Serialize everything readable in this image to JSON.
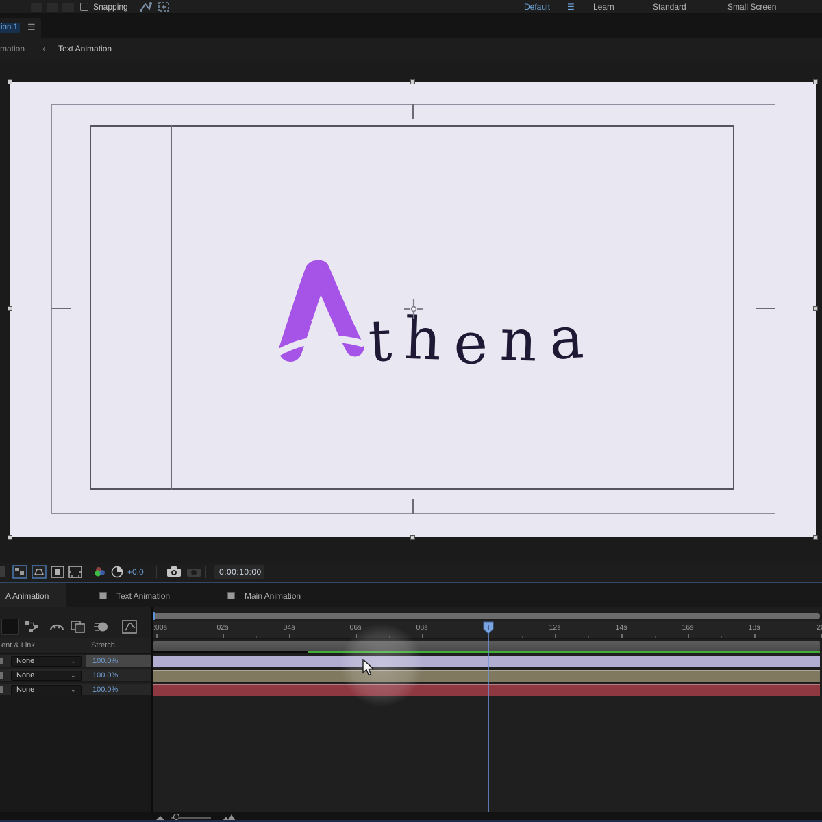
{
  "top_toolbar": {
    "snapping_label": "Snapping",
    "workspaces": [
      {
        "label": "Default",
        "active": true
      },
      {
        "label": "Learn",
        "active": false
      },
      {
        "label": "Standard",
        "active": false
      },
      {
        "label": "Small Screen",
        "active": false
      }
    ]
  },
  "comp_panel": {
    "tab_label": "ion 1",
    "breadcrumb": {
      "parent": "mation",
      "separator": "‹",
      "current": "Text Animation"
    },
    "logo": {
      "initial": "A",
      "rest": "thena",
      "purple": "#a653e8",
      "text_color": "#201936"
    },
    "exposure_value": "+0.0",
    "timecode": "0:00:10:00"
  },
  "timeline": {
    "tabs": [
      {
        "label": "A Animation",
        "active": true
      },
      {
        "label": "Text Animation",
        "active": false
      },
      {
        "label": "Main Animation",
        "active": false
      }
    ],
    "columns": {
      "parent_link": "ent & Link",
      "stretch": "Stretch"
    },
    "layers": [
      {
        "parent_value": "None",
        "stretch_value": "100.0%",
        "bar_color": "#b1aed1",
        "selected": true
      },
      {
        "parent_value": "None",
        "stretch_value": "100.0%",
        "bar_color": "#80785f",
        "selected": false
      },
      {
        "parent_value": "None",
        "stretch_value": "100.0%",
        "bar_color": "#8e3842",
        "selected": false
      }
    ],
    "ruler": [
      {
        "label": ":00s",
        "sec": 0
      },
      {
        "label": "02s",
        "sec": 2
      },
      {
        "label": "04s",
        "sec": 4
      },
      {
        "label": "06s",
        "sec": 6
      },
      {
        "label": "08s",
        "sec": 8
      },
      {
        "label": "12s",
        "sec": 12
      },
      {
        "label": "14s",
        "sec": 14
      },
      {
        "label": "16s",
        "sec": 16
      },
      {
        "label": "18s",
        "sec": 18
      },
      {
        "label": "20",
        "sec": 20
      }
    ],
    "playhead_seconds": 10
  },
  "colors": {
    "accent_blue": "#6fa6dd",
    "value_blue": "#6f9fd4",
    "render_green": "#41ae39",
    "canvas": "#e9e8f2"
  }
}
